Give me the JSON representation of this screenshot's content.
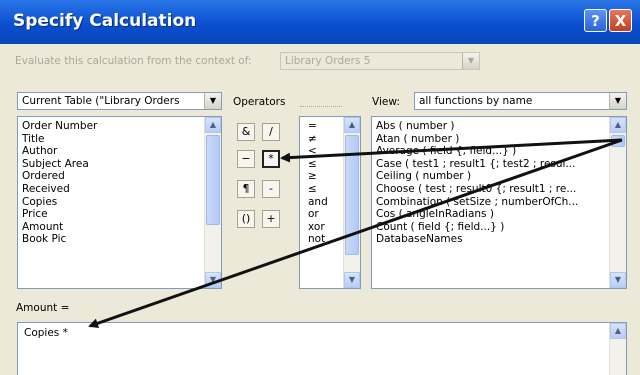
{
  "window": {
    "title": "Specify Calculation",
    "help_glyph": "?",
    "close_glyph": "X"
  },
  "context": {
    "label": "Evaluate this calculation from the context of:",
    "value": "Library Orders 5"
  },
  "fields": {
    "table_select": "Current Table (\"Library Orders",
    "items": [
      "Order Number",
      "Title",
      "Author",
      "Subject Area",
      "Ordered",
      "Received",
      "Copies",
      "Price",
      "Amount",
      "Book Pic"
    ]
  },
  "operators": {
    "label": "Operators",
    "buttons": [
      "&",
      "/",
      "−",
      "*",
      "¶",
      "-",
      "()",
      "+"
    ],
    "list": [
      "=",
      "≠",
      "<",
      "≤",
      "≥",
      "≤",
      "and",
      "or",
      "xor",
      "not"
    ]
  },
  "functions": {
    "view_label": "View:",
    "view_value": "all functions by name",
    "items": [
      "Abs ( number )",
      "Atan ( number )",
      "Average ( field {; field...} )",
      "Case ( test1 ; result1 {; test2 ; resul...",
      "Ceiling ( number )",
      "Choose ( test ; result0 {; result1 ; re...",
      "Combination ( setSize ; numberOfCh...",
      "Cos ( angleInRadians )",
      "Count ( field {; field...} )",
      "DatabaseNames"
    ]
  },
  "calculation": {
    "label": "Amount =",
    "formula": "Copies *"
  },
  "icons": {
    "dropdown": "▼",
    "scroll_up": "▲",
    "scroll_down": "▼"
  }
}
